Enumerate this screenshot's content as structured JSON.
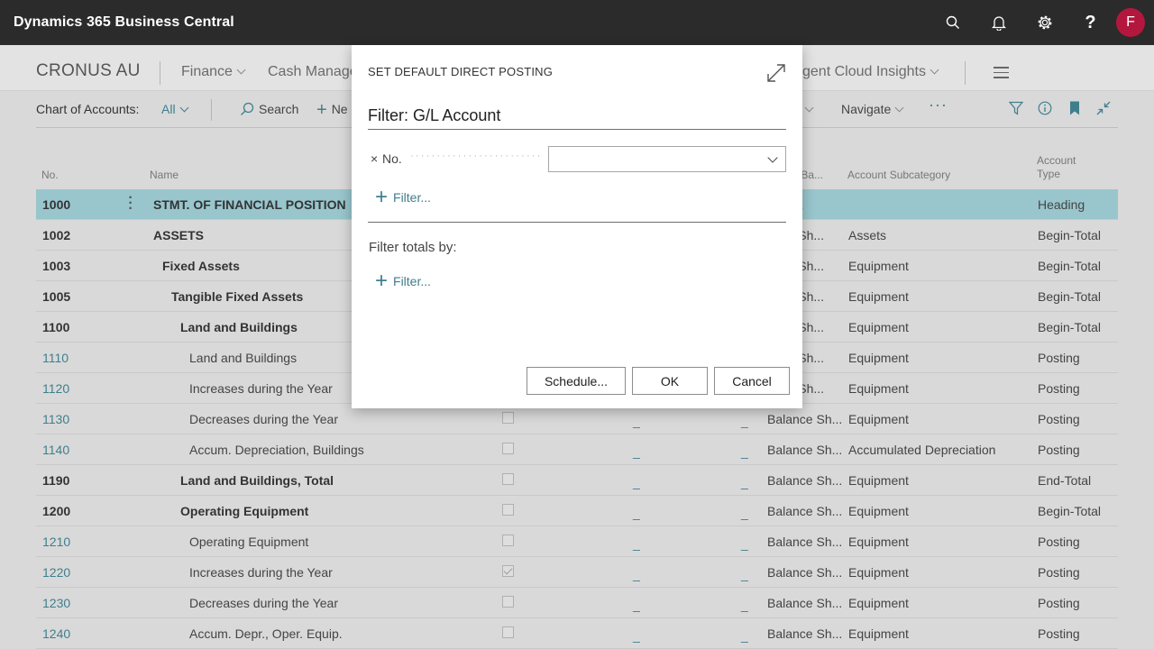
{
  "topbar": {
    "title": "Dynamics 365 Business Central",
    "avatar_initial": "F"
  },
  "nav": {
    "company": "CRONUS AU",
    "items": [
      "Finance",
      "Cash Manage",
      "gent Cloud Insights"
    ]
  },
  "actionbar": {
    "page_label": "Chart of Accounts:",
    "view": "All",
    "search": "Search",
    "new": "Ne",
    "navigate": "Navigate"
  },
  "columns": {
    "no": "No.",
    "name": "Name",
    "income_balance": "/Ba...",
    "subcategory": "Account Subcategory",
    "type_line1": "Account",
    "type_line2": "Type"
  },
  "rows": [
    {
      "no": "1000",
      "name": "STMT. OF FINANCIAL POSITION",
      "bs": "e Sh...",
      "sub": "",
      "type": "Heading"
    },
    {
      "no": "1002",
      "name": "ASSETS",
      "bs": "ance Sh...",
      "sub": "Assets",
      "type": "Begin-Total"
    },
    {
      "no": "1003",
      "name": "Fixed Assets",
      "bs": "ance Sh...",
      "sub": "Equipment",
      "type": "Begin-Total"
    },
    {
      "no": "1005",
      "name": "Tangible Fixed Assets",
      "bs": "ance Sh...",
      "sub": "Equipment",
      "type": "Begin-Total"
    },
    {
      "no": "1100",
      "name": "Land and Buildings",
      "bs": "ance Sh...",
      "sub": "Equipment",
      "type": "Begin-Total"
    },
    {
      "no": "1110",
      "name": "Land and Buildings",
      "bs": "ance Sh...",
      "sub": "Equipment",
      "type": "Posting"
    },
    {
      "no": "1120",
      "name": "Increases during the Year",
      "bs": "ance Sh...",
      "sub": "Equipment",
      "type": "Posting"
    },
    {
      "no": "1130",
      "name": "Decreases during the Year",
      "bs": "Balance Sh...",
      "sub": "Equipment",
      "type": "Posting"
    },
    {
      "no": "1140",
      "name": "Accum. Depreciation, Buildings",
      "bs": "Balance Sh...",
      "sub": "Accumulated Depreciation",
      "type": "Posting"
    },
    {
      "no": "1190",
      "name": "Land and Buildings, Total",
      "bs": "Balance Sh...",
      "sub": "Equipment",
      "type": "End-Total"
    },
    {
      "no": "1200",
      "name": "Operating Equipment",
      "bs": "Balance Sh...",
      "sub": "Equipment",
      "type": "Begin-Total"
    },
    {
      "no": "1210",
      "name": "Operating Equipment",
      "bs": "Balance Sh...",
      "sub": "Equipment",
      "type": "Posting"
    },
    {
      "no": "1220",
      "name": "Increases during the Year",
      "bs": "Balance Sh...",
      "sub": "Equipment",
      "type": "Posting"
    },
    {
      "no": "1230",
      "name": "Decreases during the Year",
      "bs": "Balance Sh...",
      "sub": "Equipment",
      "type": "Posting"
    },
    {
      "no": "1240",
      "name": "Accum. Depr., Oper. Equip.",
      "bs": "Balance Sh...",
      "sub": "Equipment",
      "type": "Posting"
    }
  ],
  "dash": "_",
  "dialog": {
    "title": "SET DEFAULT DIRECT POSTING",
    "filter_title": "Filter: G/L Account",
    "field_label": "No.",
    "field_x": "×",
    "field_value": "",
    "add_filter": "Filter...",
    "totals_label": "Filter totals by:",
    "add_totals_filter": "Filter...",
    "schedule_button": "Schedule...",
    "ok_button": "OK",
    "cancel_button": "Cancel"
  },
  "colors": {
    "accent": "#3f7f8c",
    "selected_row": "#99c6cd",
    "topbar": "#2b2b2b",
    "avatar": "#b4173d"
  }
}
